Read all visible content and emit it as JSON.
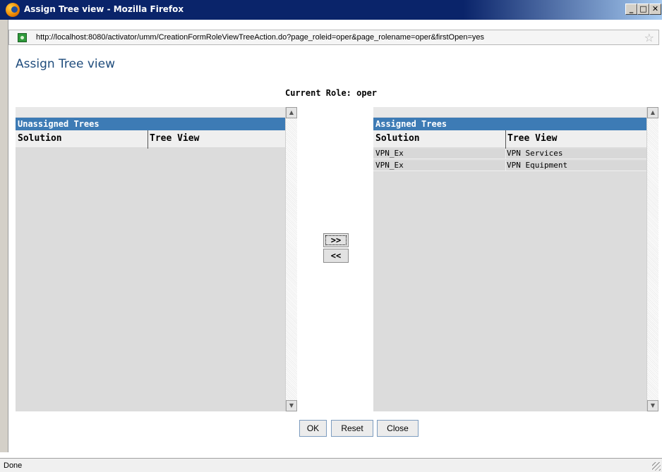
{
  "window": {
    "title": "Assign Tree view - Mozilla Firefox",
    "minimize": "_",
    "maximize": "□",
    "close": "✕"
  },
  "urlbar": {
    "url": "http://localhost:8080/activator/umm/CreationFormRoleViewTreeAction.do?page_roleid=oper&page_rolename=oper&firstOpen=yes",
    "bookmark_icon": "☆"
  },
  "page": {
    "heading": "Assign Tree view",
    "current_role": "Current Role: oper"
  },
  "unassigned": {
    "title": "Unassigned Trees",
    "col_solution": "Solution",
    "col_tree_view": "Tree View",
    "rows": []
  },
  "assigned": {
    "title": "Assigned Trees",
    "col_solution": "Solution",
    "col_tree_view": "Tree View",
    "rows": [
      {
        "solution": "VPN_Ex",
        "tree_view": "VPN Services"
      },
      {
        "solution": "VPN_Ex",
        "tree_view": "VPN Equipment"
      }
    ]
  },
  "controls": {
    "assign": ">>",
    "unassign": "<<",
    "ok": "OK",
    "reset": "Reset",
    "close": "Close"
  },
  "scroll": {
    "up": "▲",
    "down": "▼"
  },
  "status": {
    "text": "Done"
  }
}
